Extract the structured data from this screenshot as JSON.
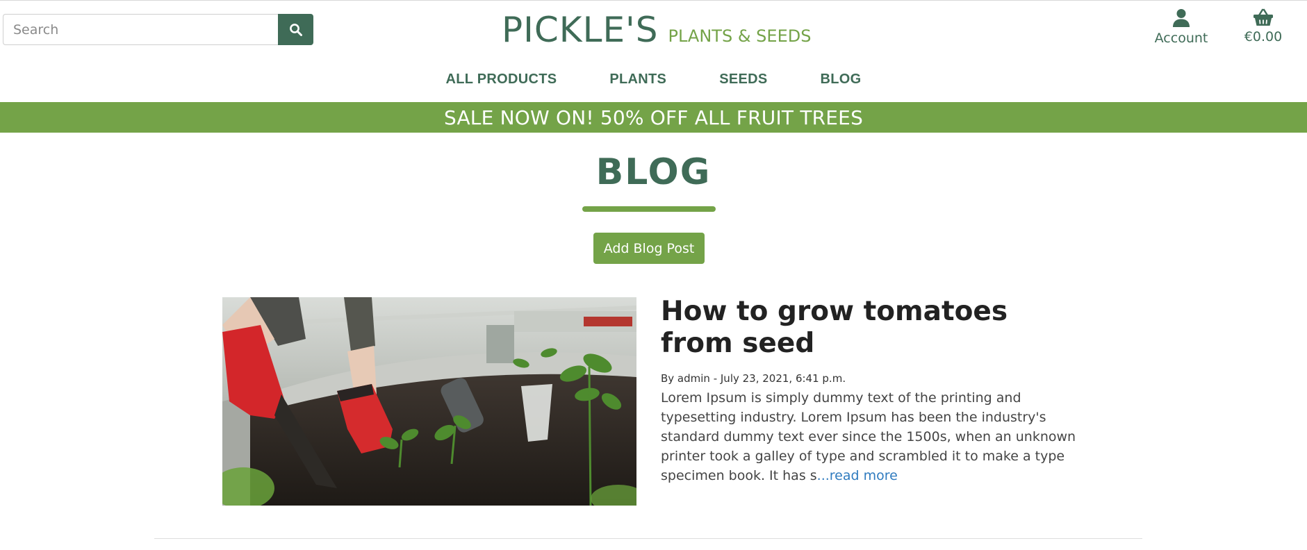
{
  "search": {
    "placeholder": "Search",
    "value": "",
    "icon": "search-icon"
  },
  "logo": {
    "brand": "PICKLE'S",
    "tagline": "PLANTS & SEEDS"
  },
  "header": {
    "account_label": "Account",
    "account_icon": "user-icon",
    "basket_label": "€0.00",
    "basket_icon": "basket-icon"
  },
  "nav": {
    "items": [
      {
        "label": "ALL PRODUCTS"
      },
      {
        "label": "PLANTS"
      },
      {
        "label": "SEEDS"
      },
      {
        "label": "BLOG"
      }
    ]
  },
  "banner": {
    "text": "SALE NOW ON! 50% OFF ALL FRUIT TREES"
  },
  "page": {
    "title": "BLOG",
    "add_button": "Add Blog Post"
  },
  "posts": [
    {
      "title": "How to grow tomatoes from seed",
      "meta": "By admin - July 23, 2021, 6:41 p.m.",
      "excerpt": "Lorem Ipsum is simply dummy text of the printing and typesetting industry. Lorem Ipsum has been the industry's standard dummy text ever since the 1500s, when an unknown printer took a galley of type and scrambled it to make a type specimen book. It has s",
      "read_more": "...read more",
      "image": "gardener-planting-seedlings-photo"
    }
  ],
  "colors": {
    "primary": "#3f6b57",
    "accent": "#74a348",
    "link": "#2f7bbf"
  }
}
